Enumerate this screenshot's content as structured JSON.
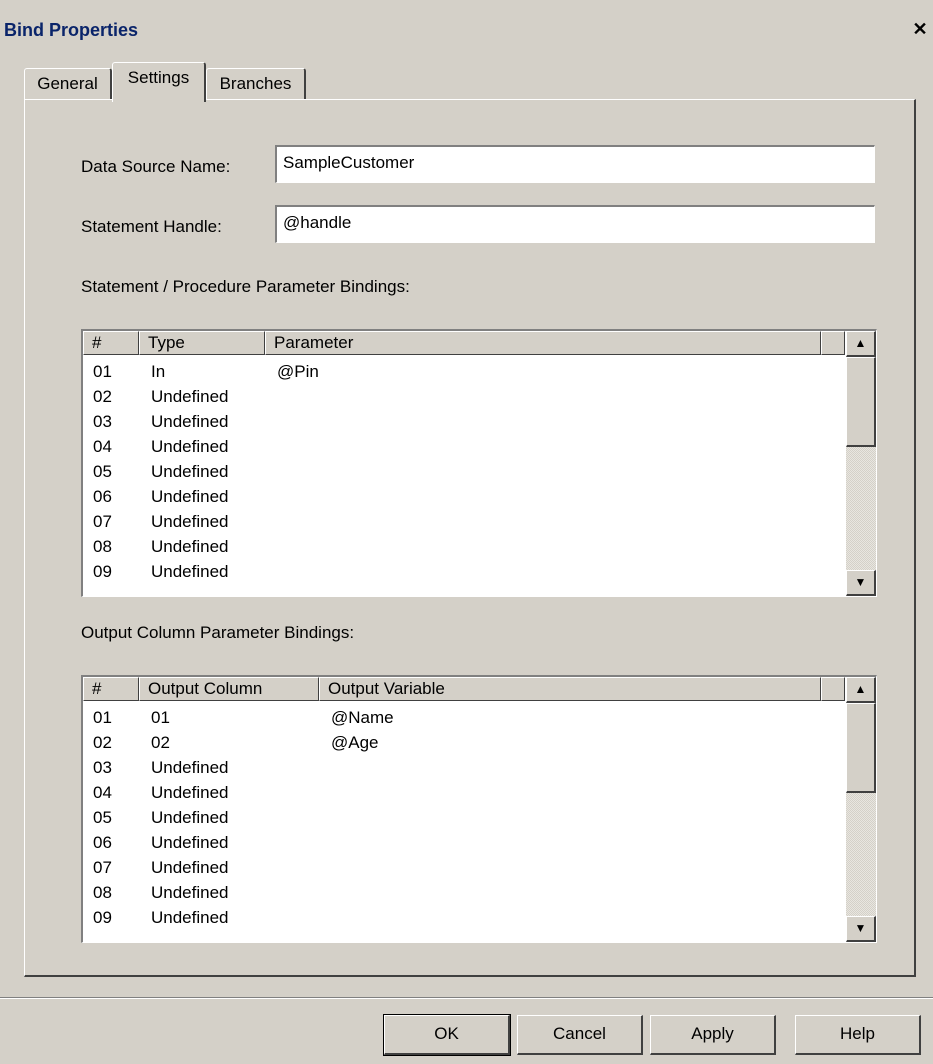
{
  "window": {
    "title": "Bind Properties",
    "close_glyph": "✕"
  },
  "tabs": [
    {
      "label": "General",
      "active": false
    },
    {
      "label": "Settings",
      "active": true
    },
    {
      "label": "Branches",
      "active": false
    }
  ],
  "form": {
    "data_source_label": "Data Source Name:",
    "data_source_value": "SampleCustomer",
    "statement_handle_label": "Statement Handle:",
    "statement_handle_value": "@handle"
  },
  "param_bindings": {
    "title": "Statement / Procedure Parameter Bindings:",
    "columns": [
      "#",
      "Type",
      "Parameter"
    ],
    "rows": [
      [
        "01",
        "In",
        "@Pin"
      ],
      [
        "02",
        "Undefined",
        ""
      ],
      [
        "03",
        "Undefined",
        ""
      ],
      [
        "04",
        "Undefined",
        ""
      ],
      [
        "05",
        "Undefined",
        ""
      ],
      [
        "06",
        "Undefined",
        ""
      ],
      [
        "07",
        "Undefined",
        ""
      ],
      [
        "08",
        "Undefined",
        ""
      ],
      [
        "09",
        "Undefined",
        ""
      ]
    ]
  },
  "output_bindings": {
    "title": "Output Column Parameter Bindings:",
    "columns": [
      "#",
      "Output Column",
      "Output Variable"
    ],
    "rows": [
      [
        "01",
        "01",
        "@Name"
      ],
      [
        "02",
        "02",
        "@Age"
      ],
      [
        "03",
        "Undefined",
        ""
      ],
      [
        "04",
        "Undefined",
        ""
      ],
      [
        "05",
        "Undefined",
        ""
      ],
      [
        "06",
        "Undefined",
        ""
      ],
      [
        "07",
        "Undefined",
        ""
      ],
      [
        "08",
        "Undefined",
        ""
      ],
      [
        "09",
        "Undefined",
        ""
      ]
    ]
  },
  "scroll_glyphs": {
    "up": "▲",
    "down": "▼"
  },
  "buttons": {
    "ok": "OK",
    "cancel": "Cancel",
    "apply": "Apply",
    "help": "Help"
  },
  "colors": {
    "face": "#d4d0c8",
    "title_text": "#0a246a",
    "field_bg": "#ffffff"
  }
}
